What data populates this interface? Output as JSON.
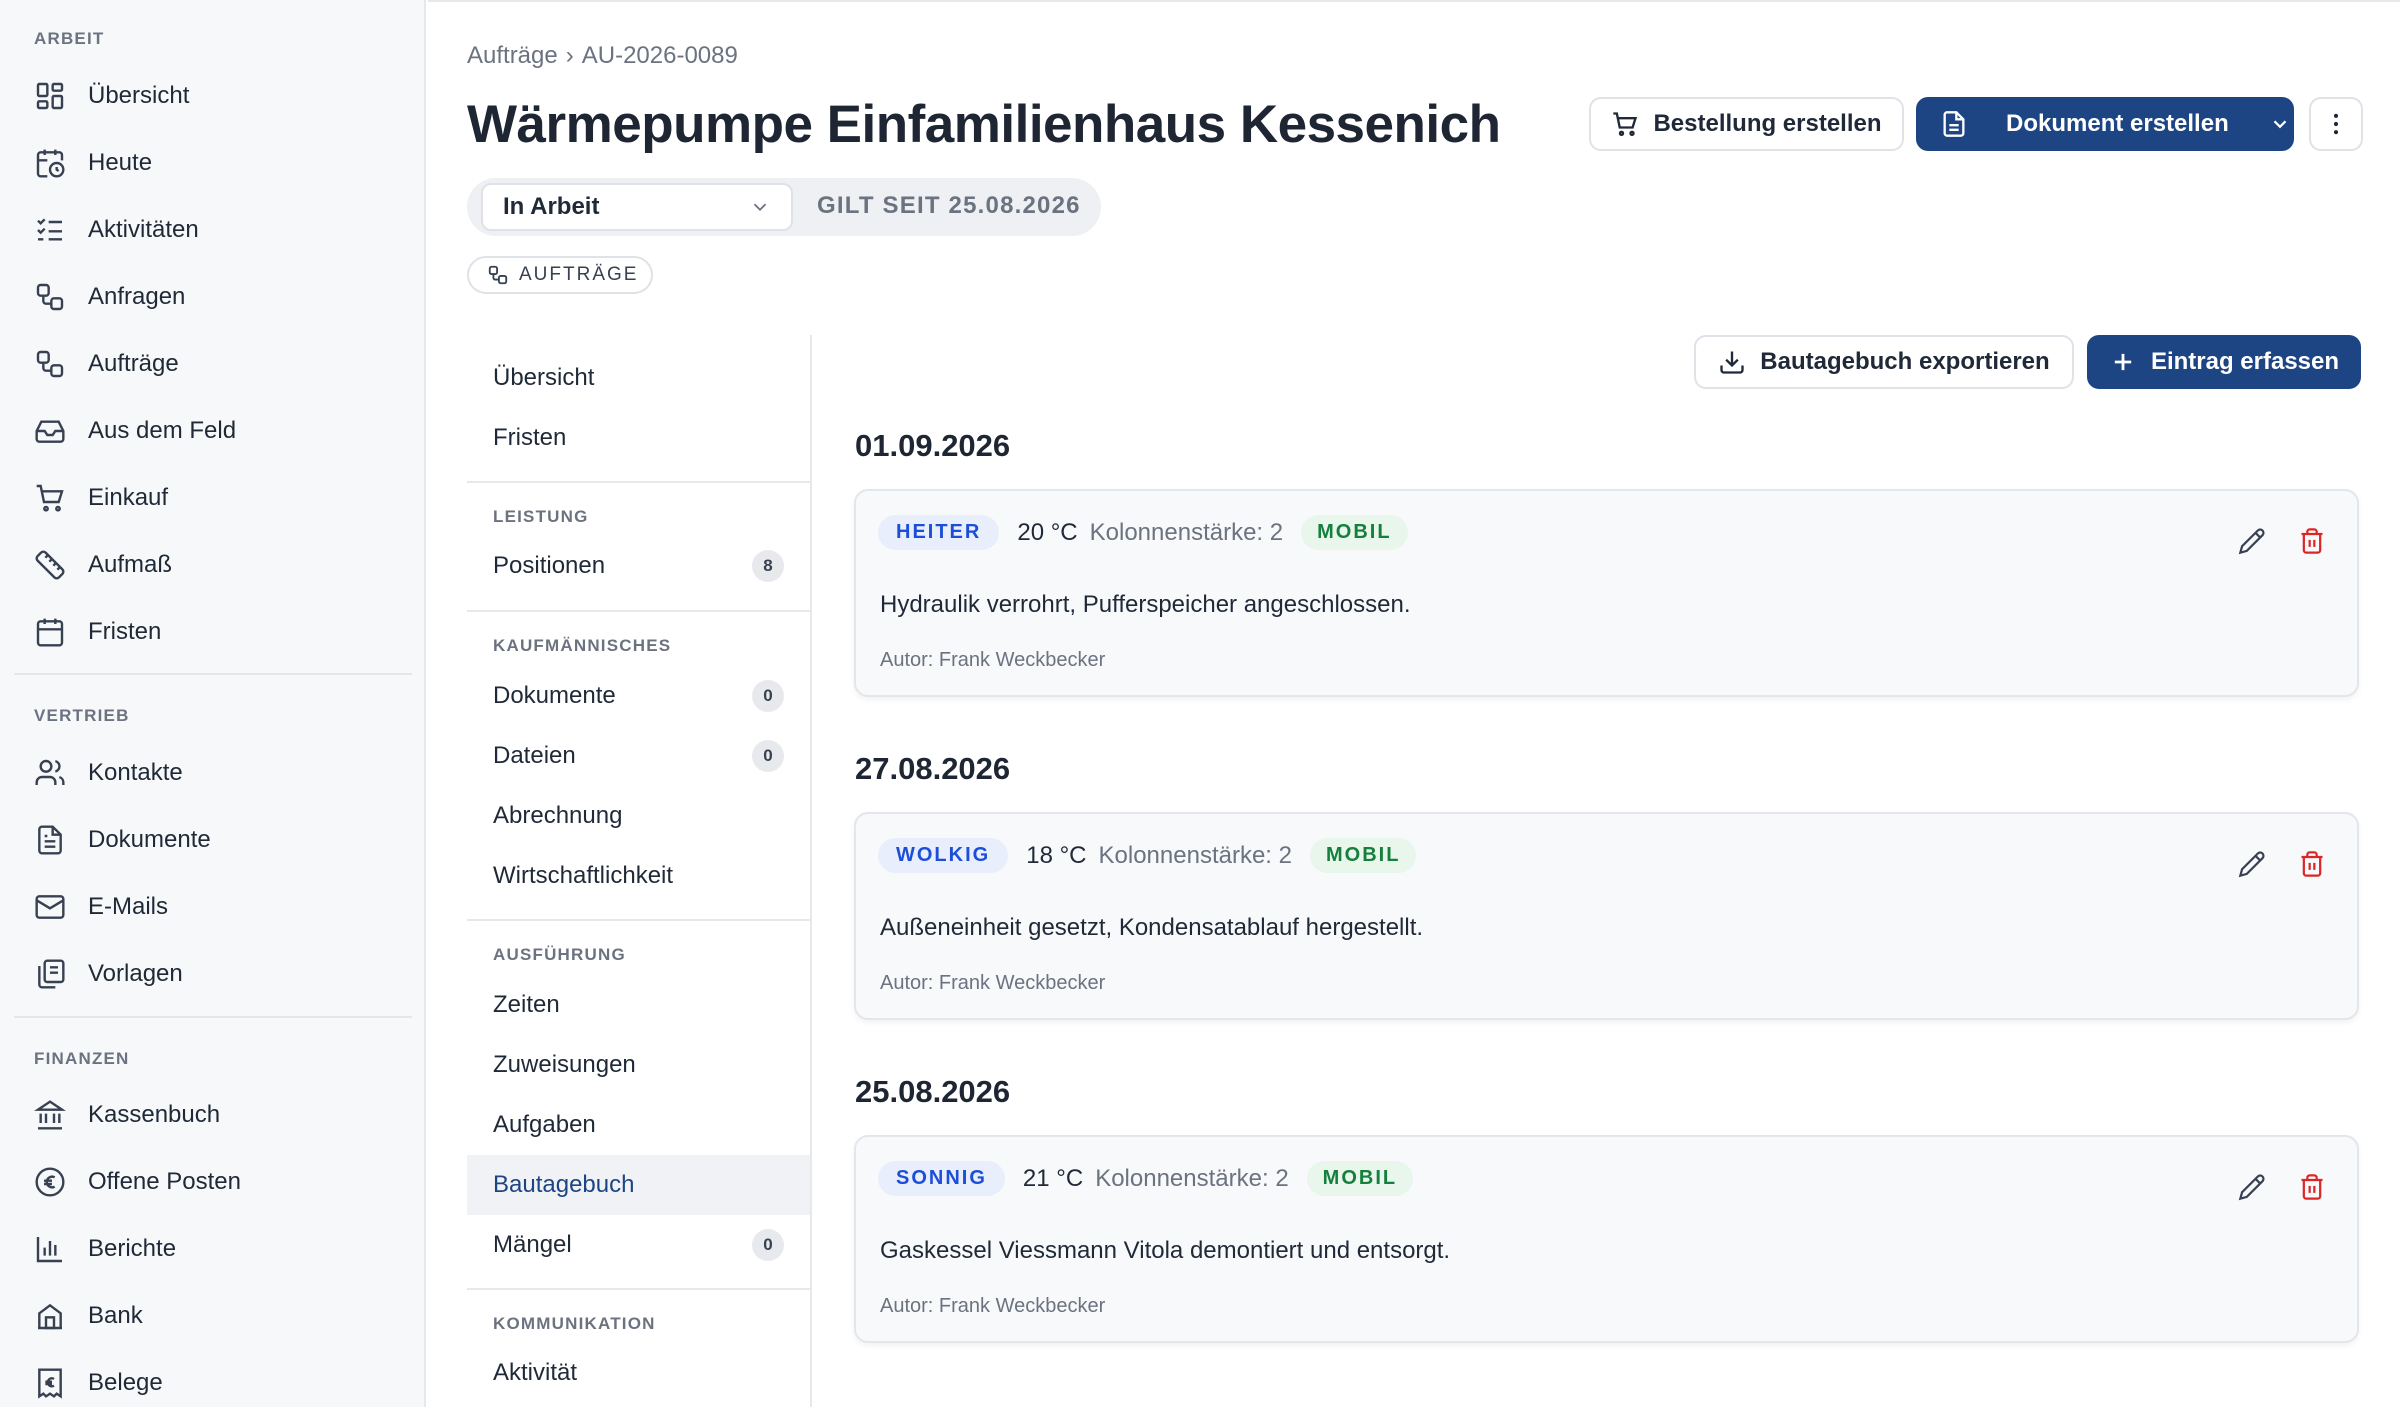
{
  "sidebar": {
    "sections": [
      {
        "label": "ARBEIT",
        "items": [
          {
            "label": "Übersicht",
            "icon": "dashboard-icon"
          },
          {
            "label": "Heute",
            "icon": "calendar-clock-icon"
          },
          {
            "label": "Aktivitäten",
            "icon": "checklist-icon"
          },
          {
            "label": "Anfragen",
            "icon": "workflow-icon"
          },
          {
            "label": "Aufträge",
            "icon": "workflow-icon"
          },
          {
            "label": "Aus dem Feld",
            "icon": "inbox-icon"
          },
          {
            "label": "Einkauf",
            "icon": "cart-icon"
          },
          {
            "label": "Aufmaß",
            "icon": "ruler-icon"
          },
          {
            "label": "Fristen",
            "icon": "calendar-icon"
          }
        ]
      },
      {
        "label": "VERTRIEB",
        "items": [
          {
            "label": "Kontakte",
            "icon": "users-icon"
          },
          {
            "label": "Dokumente",
            "icon": "document-icon"
          },
          {
            "label": "E-Mails",
            "icon": "mail-icon"
          },
          {
            "label": "Vorlagen",
            "icon": "copy-icon"
          }
        ]
      },
      {
        "label": "FINANZEN",
        "items": [
          {
            "label": "Kassenbuch",
            "icon": "bank-icon"
          },
          {
            "label": "Offene Posten",
            "icon": "euro-circle-icon"
          },
          {
            "label": "Berichte",
            "icon": "bar-chart-icon"
          },
          {
            "label": "Bank",
            "icon": "building-bank-icon"
          },
          {
            "label": "Belege",
            "icon": "receipt-euro-icon"
          }
        ]
      }
    ]
  },
  "header": {
    "breadcrumb": {
      "parent": "Aufträge",
      "separator": "›",
      "current": "AU-2026-0089"
    },
    "title": "Wärmepumpe Einfamilienhaus Kessenich",
    "status": "In Arbeit",
    "status_since": "GILT SEIT 25.08.2026",
    "tag": "AUFTRÄGE",
    "actions": {
      "order_label": "Bestellung erstellen",
      "document_label": "Dokument erstellen"
    }
  },
  "subnav": {
    "top": [
      "Übersicht",
      "Fristen"
    ],
    "groups": [
      {
        "label": "LEISTUNG",
        "items": [
          {
            "label": "Positionen",
            "count": "8"
          }
        ]
      },
      {
        "label": "KAUFMÄNNISCHES",
        "items": [
          {
            "label": "Dokumente",
            "count": "0"
          },
          {
            "label": "Dateien",
            "count": "0"
          },
          {
            "label": "Abrechnung"
          },
          {
            "label": "Wirtschaftlichkeit"
          }
        ]
      },
      {
        "label": "AUSFÜHRUNG",
        "items": [
          {
            "label": "Zeiten"
          },
          {
            "label": "Zuweisungen"
          },
          {
            "label": "Aufgaben"
          },
          {
            "label": "Bautagebuch",
            "active": true
          },
          {
            "label": "Mängel",
            "count": "0"
          }
        ]
      },
      {
        "label": "KOMMUNIKATION",
        "items": [
          {
            "label": "Aktivität"
          }
        ]
      }
    ]
  },
  "main": {
    "export_label": "Bautagebuch exportieren",
    "add_label": "Eintrag erfassen",
    "entries": [
      {
        "date": "01.09.2026",
        "weather": "HEITER",
        "temp": "20 °C",
        "crew": "Kolonnenstärke: 2",
        "source": "MOBIL",
        "text": "Hydraulik verrohrt, Pufferspeicher angeschlossen.",
        "author": "Autor: Frank Weckbecker"
      },
      {
        "date": "27.08.2026",
        "weather": "WOLKIG",
        "temp": "18 °C",
        "crew": "Kolonnenstärke: 2",
        "source": "MOBIL",
        "text": "Außeneinheit gesetzt, Kondensatablauf hergestellt.",
        "author": "Autor: Frank Weckbecker"
      },
      {
        "date": "25.08.2026",
        "weather": "SONNIG",
        "temp": "21 °C",
        "crew": "Kolonnenstärke: 2",
        "source": "MOBIL",
        "text": "Gaskessel Viessmann Vitola demontiert und entsorgt.",
        "author": "Autor: Frank Weckbecker"
      }
    ]
  },
  "colors": {
    "primary": "#1d4584",
    "delete": "#dc2626",
    "weather": "#1d4ed8",
    "mobil": "#15803d"
  }
}
